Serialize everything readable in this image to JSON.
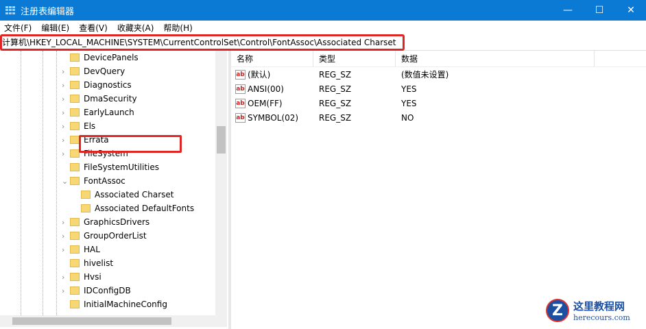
{
  "window": {
    "title": "注册表编辑器",
    "minimize": "—",
    "maximize": "☐",
    "close": "✕"
  },
  "menu": [
    "文件(F)",
    "编辑(E)",
    "查看(V)",
    "收藏夹(A)",
    "帮助(H)"
  ],
  "address": "计算机\\HKEY_LOCAL_MACHINE\\SYSTEM\\CurrentControlSet\\Control\\FontAssoc\\Associated Charset",
  "tree": [
    {
      "label": "DevicePanels",
      "level": 1,
      "arrow": ""
    },
    {
      "label": "DevQuery",
      "level": 1,
      "arrow": "›"
    },
    {
      "label": "Diagnostics",
      "level": 1,
      "arrow": "›"
    },
    {
      "label": "DmaSecurity",
      "level": 1,
      "arrow": "›"
    },
    {
      "label": "EarlyLaunch",
      "level": 1,
      "arrow": "›"
    },
    {
      "label": "Els",
      "level": 1,
      "arrow": "›"
    },
    {
      "label": "Errata",
      "level": 1,
      "arrow": "›"
    },
    {
      "label": "FileSystem",
      "level": 1,
      "arrow": "›"
    },
    {
      "label": "FileSystemUtilities",
      "level": 1,
      "arrow": ""
    },
    {
      "label": "FontAssoc",
      "level": 1,
      "arrow": "⌄"
    },
    {
      "label": "Associated Charset",
      "level": 2,
      "arrow": "",
      "selected": true
    },
    {
      "label": "Associated DefaultFonts",
      "level": 2,
      "arrow": ""
    },
    {
      "label": "GraphicsDrivers",
      "level": 1,
      "arrow": "›"
    },
    {
      "label": "GroupOrderList",
      "level": 1,
      "arrow": "›"
    },
    {
      "label": "HAL",
      "level": 1,
      "arrow": "›"
    },
    {
      "label": "hivelist",
      "level": 1,
      "arrow": ""
    },
    {
      "label": "Hvsi",
      "level": 1,
      "arrow": "›"
    },
    {
      "label": "IDConfigDB",
      "level": 1,
      "arrow": "›"
    },
    {
      "label": "InitialMachineConfig",
      "level": 1,
      "arrow": ""
    }
  ],
  "columns": [
    "名称",
    "类型",
    "数据"
  ],
  "values": [
    {
      "name": "(默认)",
      "type": "REG_SZ",
      "data": "(数值未设置)"
    },
    {
      "name": "ANSI(00)",
      "type": "REG_SZ",
      "data": "YES"
    },
    {
      "name": "OEM(FF)",
      "type": "REG_SZ",
      "data": "YES"
    },
    {
      "name": "SYMBOL(02)",
      "type": "REG_SZ",
      "data": "NO"
    }
  ],
  "value_icon": "ab",
  "watermark": {
    "name": "这里教程网",
    "url": "herecours.com"
  }
}
